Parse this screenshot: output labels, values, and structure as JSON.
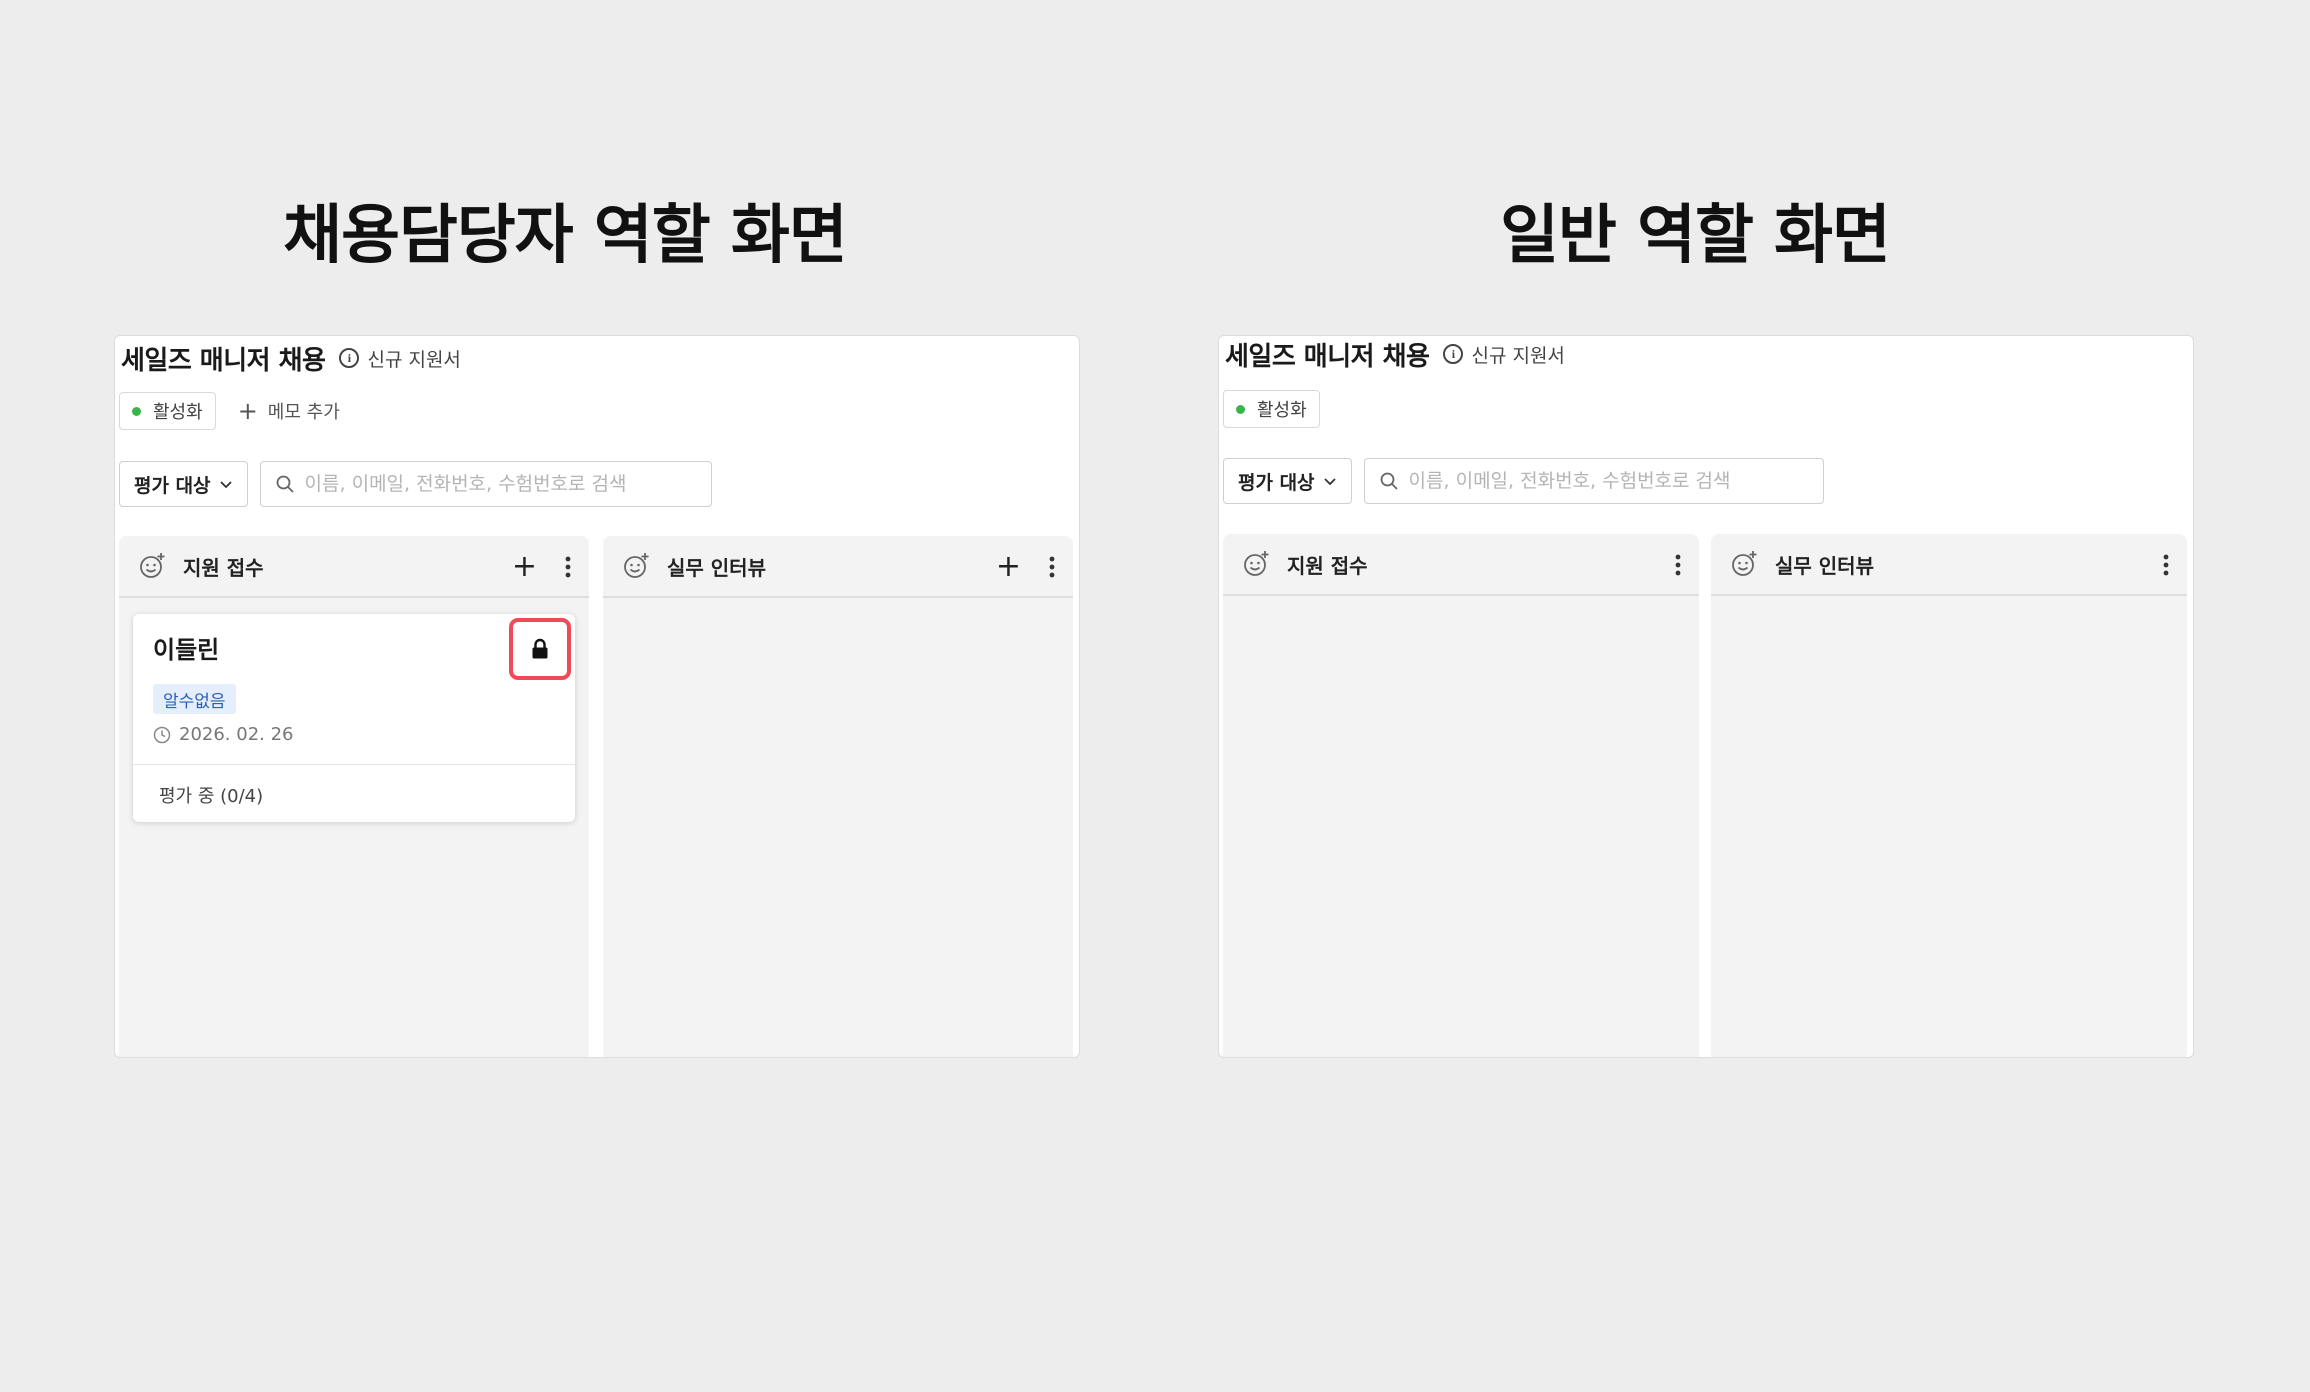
{
  "headings": {
    "left": "채용담당자 역할 화면",
    "right": "일반 역할 화면"
  },
  "panels": {
    "left": {
      "title": "세일즈 매니저 채용",
      "info_text": "신규 지원서",
      "status_label": "활성화",
      "memo_label": "메모 추가",
      "filter_label": "평가 대상",
      "search_placeholder": "이름, 이메일, 전화번호, 수험번호로 검색",
      "columns": [
        {
          "title": "지원 접수"
        },
        {
          "title": "실무 인터뷰"
        }
      ],
      "card": {
        "name": "이들린",
        "tag": "알수없음",
        "date": "2026. 02. 26",
        "eval_status": "평가 중 (0/4)"
      }
    },
    "right": {
      "title": "세일즈 매니저 채용",
      "info_text": "신규 지원서",
      "status_label": "활성화",
      "filter_label": "평가 대상",
      "search_placeholder": "이름, 이메일, 전화번호, 수험번호로 검색",
      "columns": [
        {
          "title": "지원 접수"
        },
        {
          "title": "실무 인터뷰"
        }
      ]
    }
  },
  "icons": {
    "info": "info-icon",
    "plus": "plus-icon",
    "chevron": "chevron-down-icon",
    "search": "search-icon",
    "column": "smile-plus-icon",
    "more": "more-vertical-icon",
    "lock": "lock-icon",
    "clock": "clock-icon"
  },
  "colors": {
    "background": "#ededed",
    "active_dot": "#3bb44a",
    "highlight": "#ef4b57",
    "tag_bg": "#e4eefc",
    "tag_text": "#2a5fb5"
  }
}
